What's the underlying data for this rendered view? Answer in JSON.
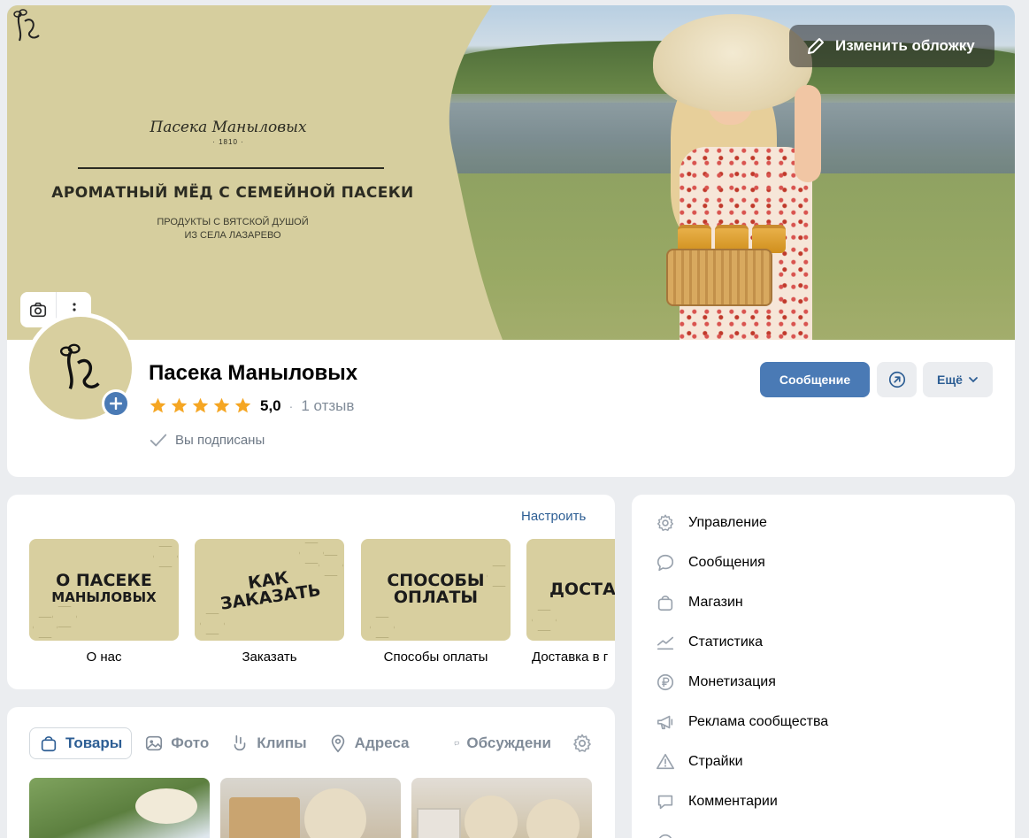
{
  "cover": {
    "brand_name": "Пасека Маныловых",
    "brand_year": "· 1810 ·",
    "headline": "АРОМАТНЫЙ МЁД С СЕМЕЙНОЙ ПАСЕКИ",
    "sub_line1": "ПРОДУКТЫ С ВЯТСКОЙ ДУШОЙ",
    "sub_line2": "ИЗ СЕЛА ЛАЗАРЕВО",
    "change_cover_label": "Изменить обложку"
  },
  "profile": {
    "name": "Пасека Маныловых",
    "rating": "5,0",
    "stars": 5,
    "rating_sep": "·",
    "reviews": "1 отзыв",
    "subscribed": "Вы подписаны"
  },
  "actions": {
    "message": "Сообщение",
    "more": "Ещё"
  },
  "links": {
    "configure": "Настроить",
    "items": [
      {
        "tile_line1": "О ПАСЕКЕ",
        "tile_line2": "МАНЫЛОВЫХ",
        "label": "О нас"
      },
      {
        "tile_line1": "КАК",
        "tile_line2": "ЗАКАЗАТЬ",
        "label": "Заказать"
      },
      {
        "tile_line1": "СПОСОБЫ",
        "tile_line2": "ОПЛАТЫ",
        "label": "Способы оплаты"
      },
      {
        "tile_line1": "ДОСТА",
        "tile_line2": "",
        "label": "Доставка в г"
      }
    ]
  },
  "tabs": [
    {
      "label": "Товары",
      "icon": "bag-icon"
    },
    {
      "label": "Фото",
      "icon": "photo-icon"
    },
    {
      "label": "Клипы",
      "icon": "clips-icon"
    },
    {
      "label": "Адреса",
      "icon": "location-icon"
    },
    {
      "label": "Обсуждени",
      "icon": "discussion-icon"
    }
  ],
  "admin_menu": [
    {
      "label": "Управление",
      "icon": "gear-icon"
    },
    {
      "label": "Сообщения",
      "icon": "message-icon"
    },
    {
      "label": "Магазин",
      "icon": "shop-bag-icon"
    },
    {
      "label": "Статистика",
      "icon": "stats-icon"
    },
    {
      "label": "Монетизация",
      "icon": "ruble-icon"
    },
    {
      "label": "Реклама сообщества",
      "icon": "megaphone-icon"
    },
    {
      "label": "Страйки",
      "icon": "warning-icon"
    },
    {
      "label": "Комментарии",
      "icon": "comment-icon"
    }
  ],
  "colors": {
    "accent": "#4a7ab5",
    "link": "#2d5e94",
    "tile_bg": "#d8cf9f",
    "star": "#f5a623"
  }
}
